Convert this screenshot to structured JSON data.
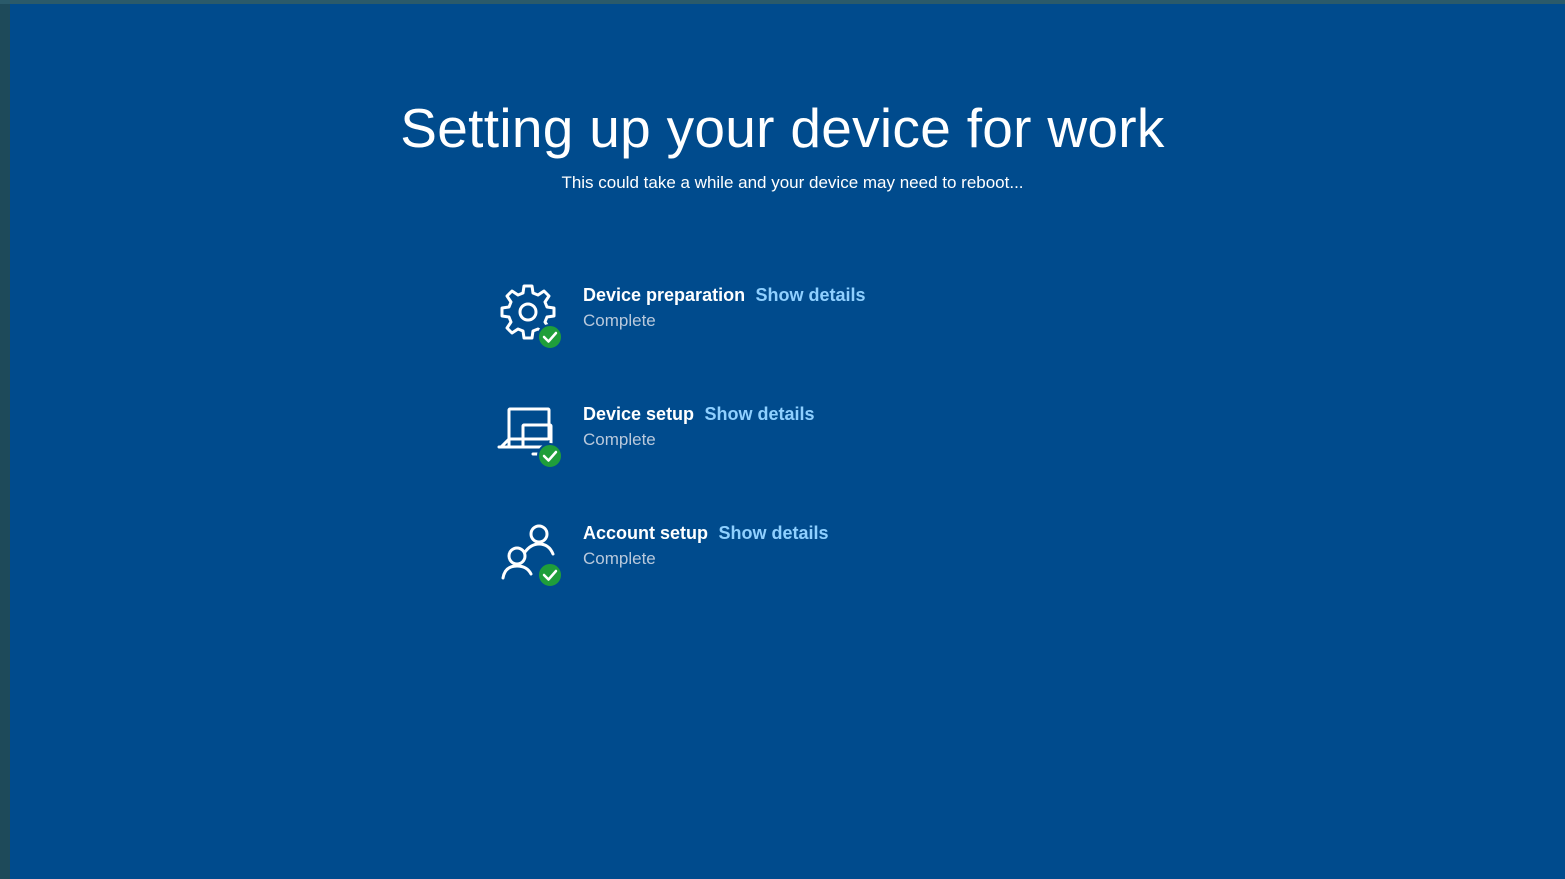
{
  "page": {
    "title": "Setting up your device for work",
    "subtitle": "This could take a while and your device may need to reboot..."
  },
  "steps": [
    {
      "icon": "gear-check-icon",
      "name": "Device preparation",
      "link": "Show details",
      "status": "Complete"
    },
    {
      "icon": "devices-check-icon",
      "name": "Device setup",
      "link": "Show details",
      "status": "Complete"
    },
    {
      "icon": "users-check-icon",
      "name": "Account setup",
      "link": "Show details",
      "status": "Complete"
    }
  ],
  "colors": {
    "background": "#004b8d",
    "link": "#8fd0ff",
    "check": "#1f9e3a"
  }
}
